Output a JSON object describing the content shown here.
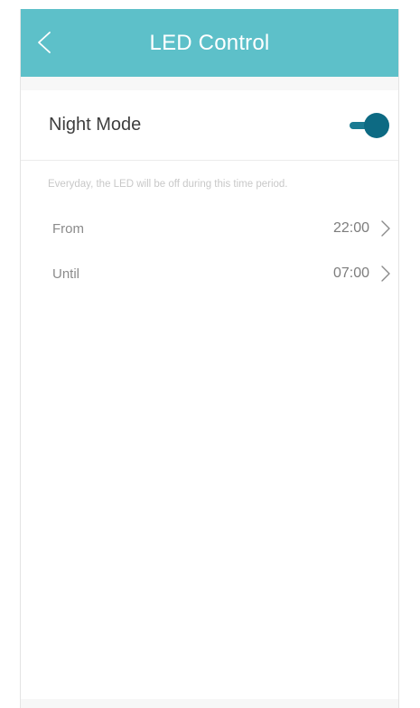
{
  "header": {
    "title": "LED Control",
    "back_icon": "chevron-left-icon"
  },
  "night_mode": {
    "label": "Night Mode",
    "enabled": true
  },
  "schedule": {
    "description": "Everyday, the LED will be off during this time period.",
    "rows": [
      {
        "label": "From",
        "value": "22:00",
        "icon": "chevron-right-icon"
      },
      {
        "label": "Until",
        "value": "07:00",
        "icon": "chevron-right-icon"
      }
    ]
  },
  "colors": {
    "header_bg": "#5dc0c9",
    "toggle_on": "#0d6a83"
  }
}
